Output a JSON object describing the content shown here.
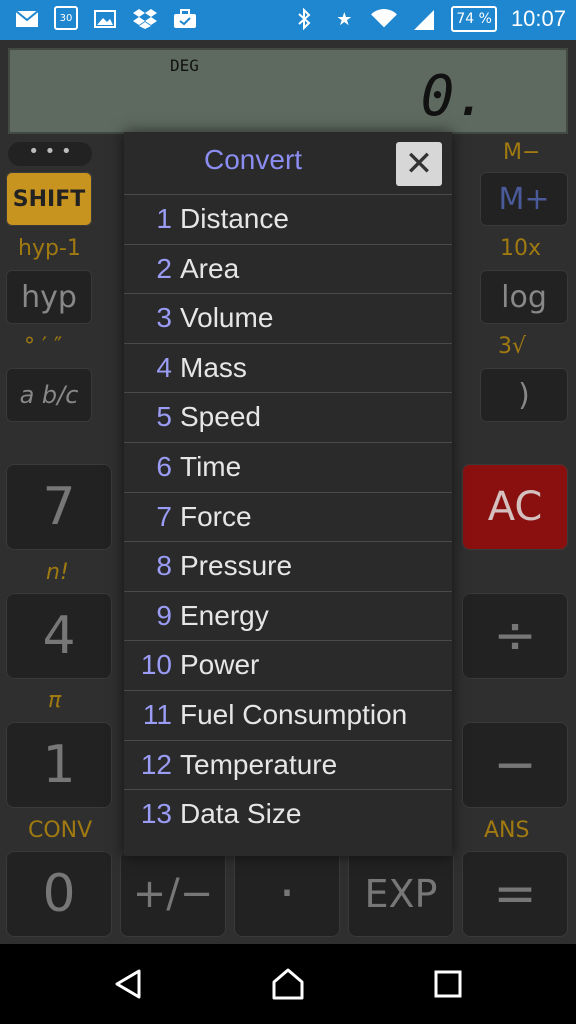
{
  "status_bar": {
    "calendar_day": "30",
    "battery": "74 %",
    "time": "10:07",
    "icons": [
      "gmail-icon",
      "calendar-icon",
      "photo-icon",
      "dropbox-icon",
      "briefcase-icon",
      "bluetooth-icon",
      "star-icon",
      "wifi-icon",
      "signal-icon",
      "battery-icon"
    ]
  },
  "display": {
    "angle_mode": "DEG",
    "value": "0."
  },
  "keys": {
    "shift": "SHIFT",
    "m_minus": "M−",
    "m_plus": "M+",
    "hyp_inverse": "hyp-1",
    "hyp": "hyp",
    "ten_x": "10x",
    "log": "log",
    "deg_min_sec": "° ′ ″",
    "cube_root": "3√",
    "fraction": "a b/c",
    "right_paren": ")",
    "seven": "7",
    "ac": "AC",
    "factorial": "n!",
    "four": "4",
    "divide": "÷",
    "pi": "π",
    "one": "1",
    "minus": "−",
    "conv": "CONV",
    "ans": "ANS",
    "zero": "0",
    "plus_minus": "+/−",
    "dot": "·",
    "exp": "EXP",
    "equals": "="
  },
  "convert_dialog": {
    "title": "Convert",
    "close_icon": "close-icon",
    "items": [
      {
        "num": "1",
        "label": "Distance"
      },
      {
        "num": "2",
        "label": "Area"
      },
      {
        "num": "3",
        "label": "Volume"
      },
      {
        "num": "4",
        "label": "Mass"
      },
      {
        "num": "5",
        "label": "Speed"
      },
      {
        "num": "6",
        "label": "Time"
      },
      {
        "num": "7",
        "label": "Force"
      },
      {
        "num": "8",
        "label": "Pressure"
      },
      {
        "num": "9",
        "label": "Energy"
      },
      {
        "num": "10",
        "label": "Power"
      },
      {
        "num": "11",
        "label": "Fuel Consumption"
      },
      {
        "num": "12",
        "label": "Temperature"
      },
      {
        "num": "13",
        "label": "Data Size"
      }
    ]
  },
  "nav_bar": {
    "icons": [
      "back-icon",
      "home-icon",
      "recents-icon"
    ]
  }
}
